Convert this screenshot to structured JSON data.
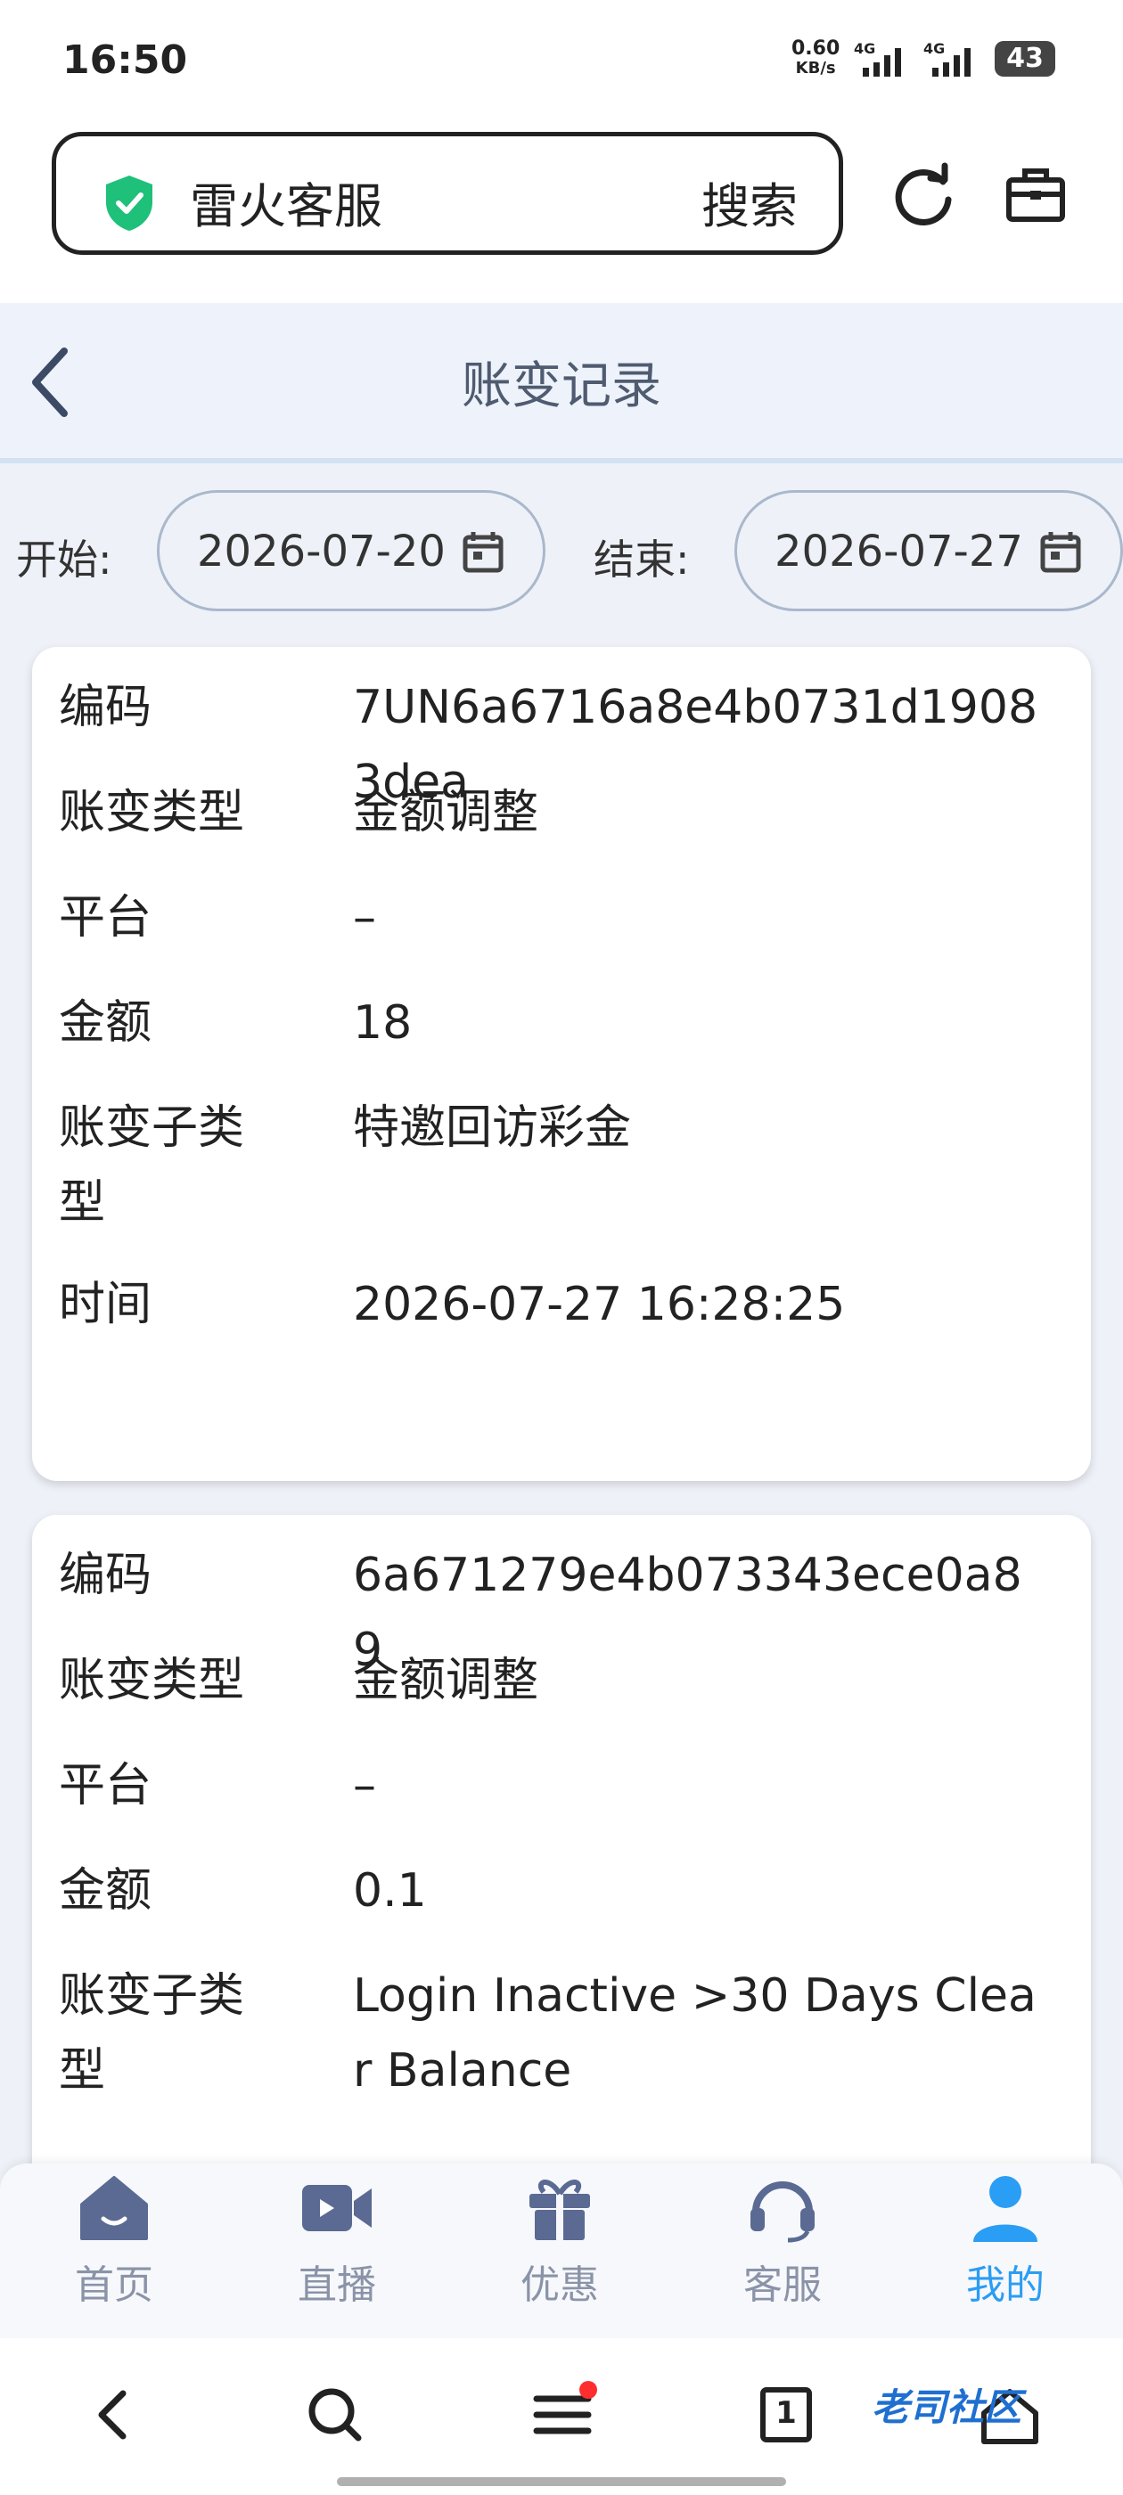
{
  "status_bar": {
    "time": "16:50",
    "net_speed": "0.60",
    "net_unit": "KB/s",
    "sim1": "4G",
    "sim2": "4G",
    "battery": "43"
  },
  "browser": {
    "url_text": "雷火客服",
    "search_label": "搜索",
    "shield_color": "#1ec07a"
  },
  "page": {
    "title": "账变记录"
  },
  "filter": {
    "start_label": "开始:",
    "start_value": "2026-07-20",
    "end_label": "结束:",
    "end_value": "2026-07-27"
  },
  "records": [
    {
      "rows": [
        {
          "label": "编码",
          "value": "7UN6a6716a8e4b0731d19083dea"
        },
        {
          "label": "账变类型",
          "value": "金额调整"
        },
        {
          "label": "平台",
          "value": "–"
        },
        {
          "label": "金额",
          "value": "18"
        },
        {
          "label": "账变子类型",
          "value": "特邀回访彩金"
        },
        {
          "label": "时间",
          "value": "2026-07-27 16:28:25"
        }
      ]
    },
    {
      "rows": [
        {
          "label": "编码",
          "value": "6a671279e4b073343ece0a89"
        },
        {
          "label": "账变类型",
          "value": "金额调整"
        },
        {
          "label": "平台",
          "value": "–"
        },
        {
          "label": "金额",
          "value": "0.1"
        },
        {
          "label": "账变子类型",
          "value": "Login Inactive >30 Days Clear Balance"
        }
      ]
    }
  ],
  "tabs": [
    {
      "label": "首页",
      "icon": "home-icon"
    },
    {
      "label": "直播",
      "icon": "video-icon"
    },
    {
      "label": "优惠",
      "icon": "gift-icon"
    },
    {
      "label": "客服",
      "icon": "headset-icon"
    },
    {
      "label": "我的",
      "icon": "user-icon"
    }
  ],
  "active_tab_color": "#2a9df4",
  "system_nav": {
    "tab_count": "1"
  },
  "watermark": "老司社区"
}
